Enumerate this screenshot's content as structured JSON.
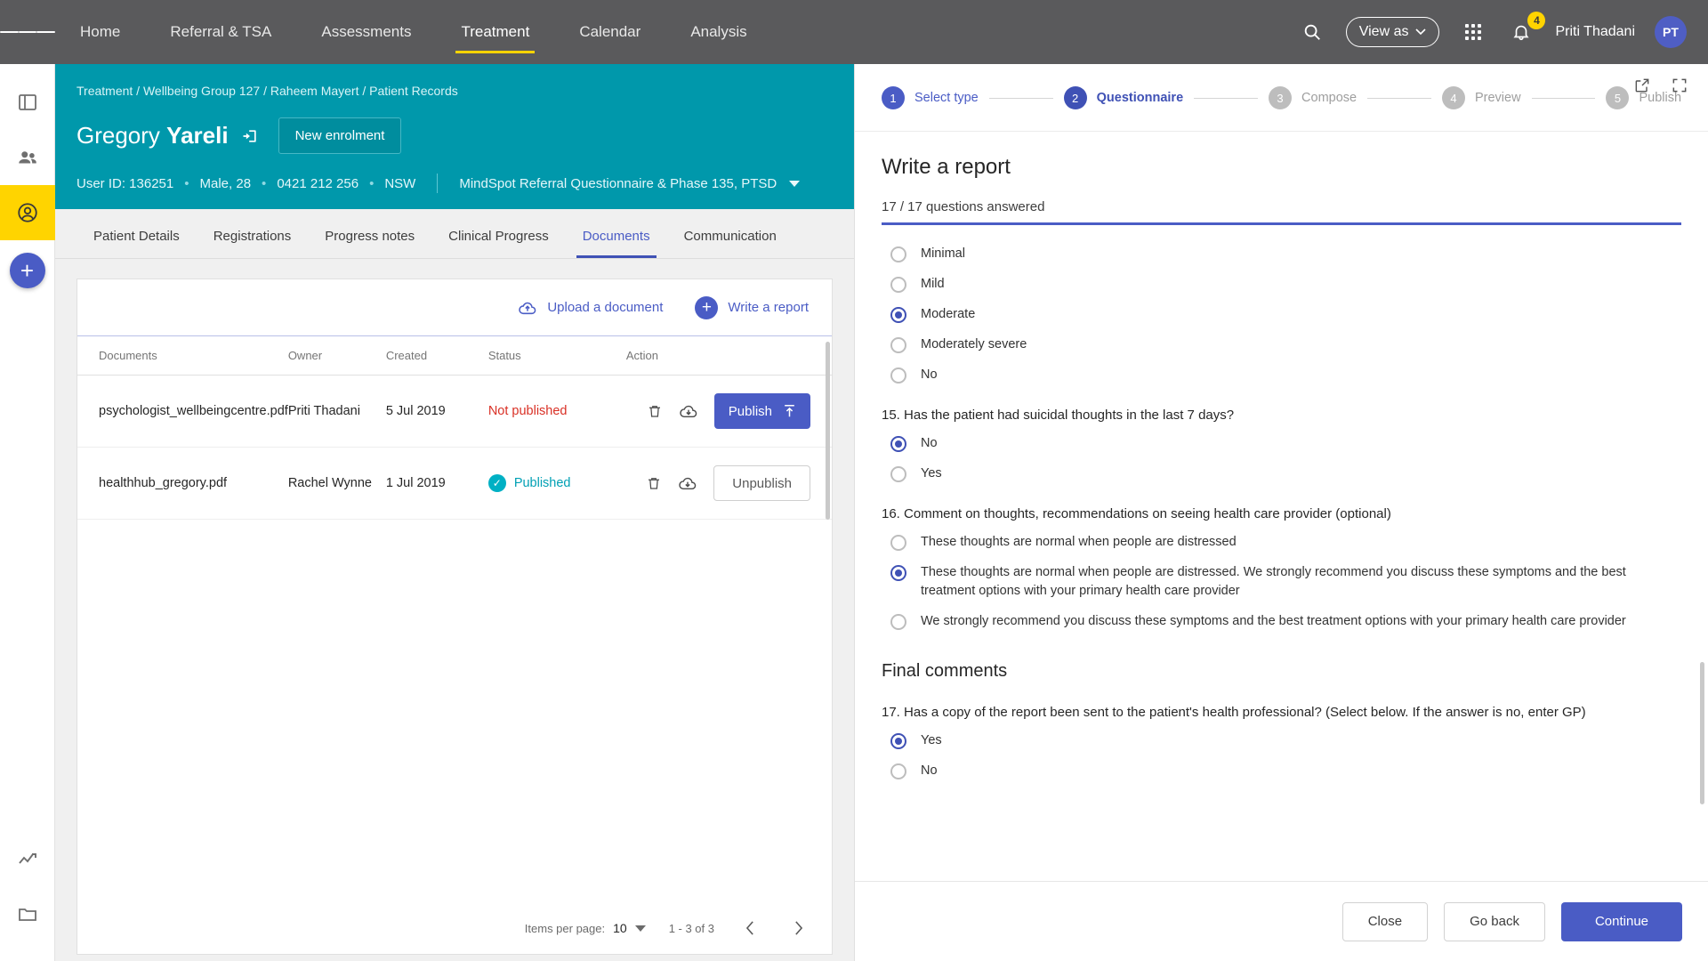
{
  "topbar": {
    "menu_icon": "hamburger-icon",
    "nav": [
      {
        "label": "Home",
        "active": false
      },
      {
        "label": "Referral & TSA",
        "active": false
      },
      {
        "label": "Assessments",
        "active": false
      },
      {
        "label": "Treatment",
        "active": true
      },
      {
        "label": "Calendar",
        "active": false
      },
      {
        "label": "Analysis",
        "active": false
      }
    ],
    "search_icon": "search-icon",
    "view_as_label": "View as",
    "apps_icon": "apps-grid-icon",
    "bell_icon": "notifications-bell-icon",
    "notification_count": "4",
    "user_name": "Priti Thadani",
    "user_initials": "PT"
  },
  "rail": {
    "items": [
      {
        "name": "panel-layout-icon"
      },
      {
        "name": "people-icon"
      },
      {
        "name": "account-circle-icon",
        "active": true
      },
      {
        "name": "add-icon"
      },
      {
        "name": "analytics-icon"
      },
      {
        "name": "folder-icon"
      }
    ]
  },
  "patient": {
    "breadcrumb": "Treatment / Wellbeing Group 127 / Raheem Mayert / Patient Records",
    "first_name": "Gregory",
    "last_name": "Yareli",
    "login_icon": "login-arrow-icon",
    "new_enrolment_label": "New enrolment",
    "user_id": "User ID: 136251",
    "gender_age": "Male, 28",
    "phone": "0421 212 256",
    "state": "NSW",
    "questionnaire": "MindSpot Referral Questionnaire & Phase 135, PTSD"
  },
  "tabs": [
    {
      "label": "Patient Details",
      "active": false
    },
    {
      "label": "Registrations",
      "active": false
    },
    {
      "label": "Progress notes",
      "active": false
    },
    {
      "label": "Clinical Progress",
      "active": false
    },
    {
      "label": "Documents",
      "active": true
    },
    {
      "label": "Communication",
      "active": false
    }
  ],
  "documents_card": {
    "upload_label": "Upload a document",
    "upload_icon": "cloud-upload-icon",
    "write_report_label": "Write a report",
    "write_report_icon": "plus-circle-icon",
    "columns": [
      "Documents",
      "Owner",
      "Created",
      "Status",
      "Action"
    ],
    "rows": [
      {
        "document": "psychologist_wellbeingcentre.pdf",
        "owner": "Priti Thadani",
        "created": "5 Jul 2019",
        "status": "Not published",
        "published": false,
        "delete_icon": "trash-icon",
        "download_icon": "cloud-download-icon",
        "action_label": "Publish",
        "action_icon": "publish-up-arrow-icon"
      },
      {
        "document": "healthhub_gregory.pdf",
        "owner": "Rachel Wynne",
        "created": "1 Jul 2019",
        "status": "Published",
        "published": true,
        "delete_icon": "trash-icon",
        "download_icon": "cloud-download-icon",
        "action_label": "Unpublish",
        "action_icon": ""
      }
    ],
    "pagination": {
      "items_per_page_label": "Items per page:",
      "items_per_page_value": "10",
      "range_label": "1 - 3 of 3",
      "prev_icon": "chevron-left-icon",
      "next_icon": "chevron-right-icon"
    }
  },
  "report_panel": {
    "open_external_icon": "open-in-new-icon",
    "fullscreen_icon": "fullscreen-icon",
    "steps": [
      {
        "num": "1",
        "label": "Select type",
        "state": "done"
      },
      {
        "num": "2",
        "label": "Questionnaire",
        "state": "cur"
      },
      {
        "num": "3",
        "label": "Compose",
        "state": "todo"
      },
      {
        "num": "4",
        "label": "Preview",
        "state": "todo"
      },
      {
        "num": "5",
        "label": "Publish",
        "state": "todo"
      }
    ],
    "title": "Write a report",
    "answered_label": "17 / 17 questions answered",
    "severity_options": [
      {
        "label": "Minimal",
        "selected": false
      },
      {
        "label": "Mild",
        "selected": false
      },
      {
        "label": "Moderate",
        "selected": true
      },
      {
        "label": "Moderately severe",
        "selected": false
      },
      {
        "label": "No",
        "selected": false
      }
    ],
    "q15": {
      "text": "15. Has the patient had suicidal thoughts in the last 7 days?",
      "options": [
        {
          "label": "No",
          "selected": true
        },
        {
          "label": "Yes",
          "selected": false
        }
      ]
    },
    "q16": {
      "text": "16. Comment on thoughts, recommendations on seeing health care provider (optional)",
      "options": [
        {
          "label": "These thoughts are normal when people are distressed",
          "selected": false
        },
        {
          "label": "These thoughts are normal when people are distressed. We strongly recommend you discuss these symptoms and the best treatment options with your primary health care provider",
          "selected": true
        },
        {
          "label": "We strongly recommend you discuss these symptoms and the best treatment options with your primary health care provider",
          "selected": false
        }
      ]
    },
    "final_section_title": "Final comments",
    "q17": {
      "text": "17. Has a copy of the report been sent to the patient's health professional? (Select below. If the answer is no, enter GP)",
      "options": [
        {
          "label": "Yes",
          "selected": true
        },
        {
          "label": "No",
          "selected": false
        }
      ]
    },
    "footer": {
      "close_label": "Close",
      "go_back_label": "Go back",
      "continue_label": "Continue"
    }
  },
  "colors": {
    "teal": "#0098ab",
    "indigo": "#4a5cc5",
    "yellow": "#ffd400",
    "danger": "#d93025",
    "topbar": "#5a5a5c"
  }
}
